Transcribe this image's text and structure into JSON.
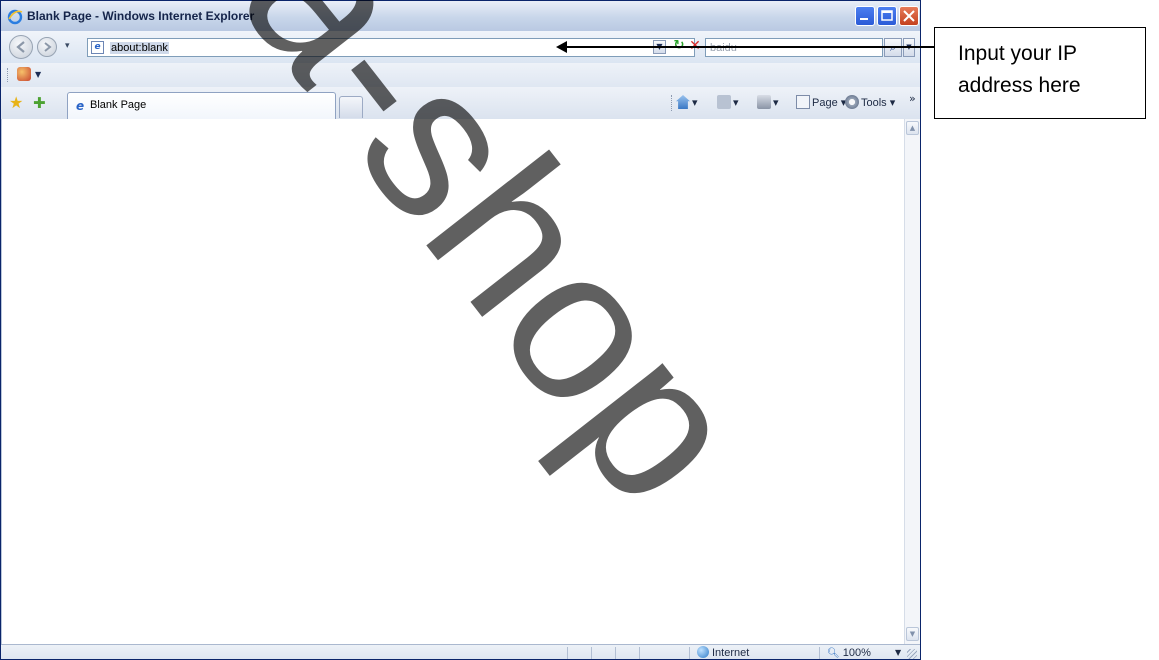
{
  "window": {
    "title": "Blank Page - Windows Internet Explorer"
  },
  "address_bar": {
    "url": "about:blank",
    "search_placeholder": "baidu"
  },
  "tabs": [
    {
      "label": "Blank Page",
      "active": true
    }
  ],
  "command_bar": {
    "page_label": "Page",
    "tools_label": "Tools"
  },
  "status_bar": {
    "zone": "Internet",
    "zoom": "100%"
  },
  "annotation": {
    "line1": "Input your IP",
    "line2": "address here"
  },
  "watermark": "eka-shop"
}
